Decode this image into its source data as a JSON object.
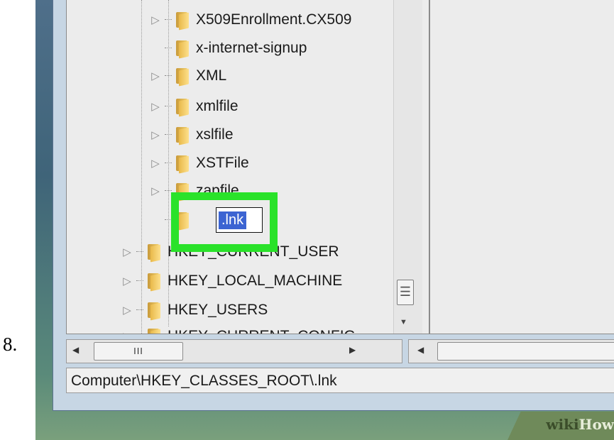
{
  "step_number": "8.",
  "tree": {
    "items": [
      {
        "label": "X509Enrollment.CX509",
        "expander": "▷"
      },
      {
        "label": "x-internet-signup",
        "expander": ""
      },
      {
        "label": "XML",
        "expander": "▷"
      },
      {
        "label": "xmlfile",
        "expander": "▷"
      },
      {
        "label": "xslfile",
        "expander": "▷"
      },
      {
        "label": "XSTFile",
        "expander": "▷"
      },
      {
        "label": "zapfile",
        "expander": "▷"
      }
    ],
    "new_key": {
      "value": ".lnk"
    },
    "roots": [
      {
        "label": "HKEY_CURRENT_USER",
        "expander": "▷"
      },
      {
        "label": "HKEY_LOCAL_MACHINE",
        "expander": "▷"
      },
      {
        "label": "HKEY_USERS",
        "expander": "▷"
      },
      {
        "label": "HKEY_CURRENT_CONFIG",
        "expander": "▷"
      }
    ]
  },
  "scrollbar": {
    "grip": "☰",
    "down_arrow": "▼",
    "left_arrow": "◀",
    "right_arrow": "▶",
    "hthumb_grip": "III"
  },
  "status_bar": {
    "path": "Computer\\HKEY_CLASSES_ROOT\\.lnk"
  },
  "watermark": {
    "part1": "wiki",
    "part2": "How"
  }
}
